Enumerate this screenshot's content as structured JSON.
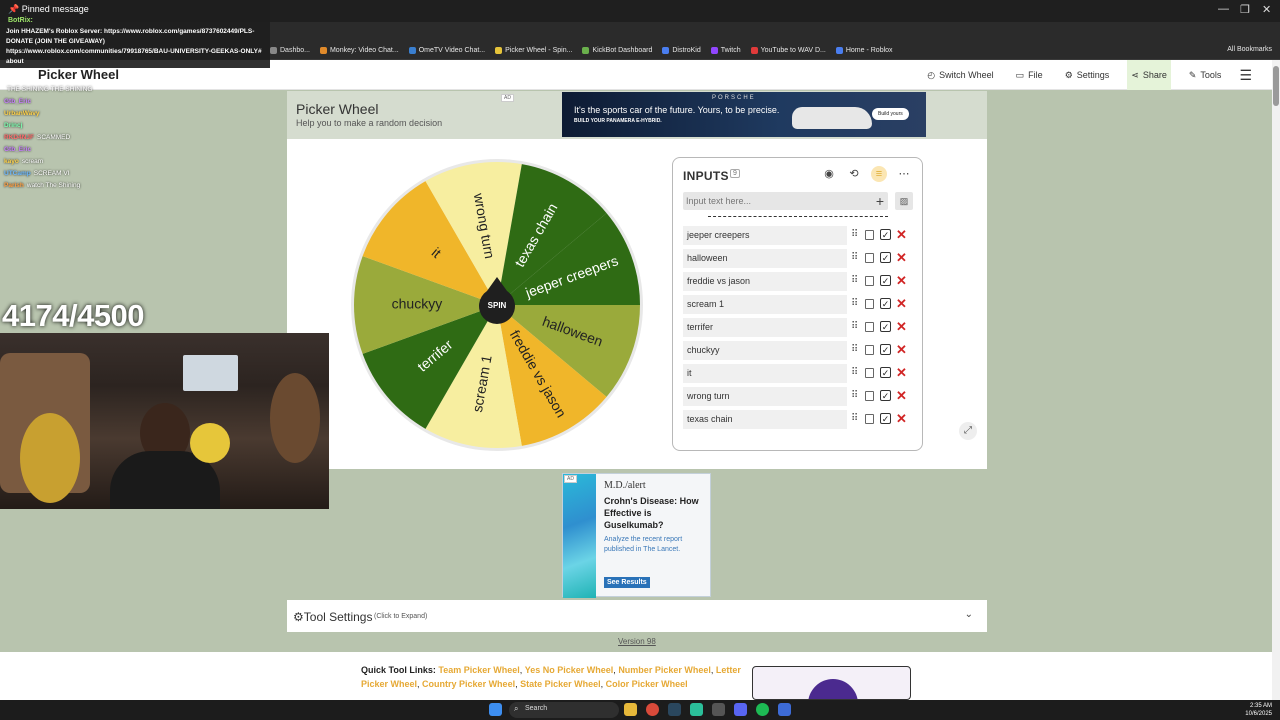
{
  "browser": {
    "bookmarks": [
      "Dashbo...",
      "Monkey: Video Chat...",
      "OmeTV Video Chat...",
      "Picker Wheel - Spin...",
      "KickBot Dashboard",
      "DistroKid",
      "Twitch",
      "YouTube to WAV D...",
      "Home - Roblox"
    ],
    "bookmark_colors": [
      "#888888",
      "#e08a2a",
      "#3a7fd0",
      "#e6c43a",
      "#6ab04c",
      "#4a7ef0",
      "#9146ff",
      "#e03a3a",
      "#4a7ef0"
    ],
    "all_bookmarks": "All Bookmarks"
  },
  "nav": {
    "brand": "Picker Wheel",
    "items": [
      {
        "label": "Switch Wheel",
        "icon": "history-icon"
      },
      {
        "label": "File",
        "icon": "file-icon"
      },
      {
        "label": "Settings",
        "icon": "gear-icon"
      },
      {
        "label": "Share",
        "icon": "share-icon"
      },
      {
        "label": "Tools",
        "icon": "tools-icon"
      }
    ]
  },
  "header": {
    "title": "Picker Wheel",
    "subtitle": "Help you to make a random decision",
    "ad_tag": "AD"
  },
  "ad_top": {
    "brand": "PORSCHE",
    "line1": "It's the sports car of the future. Yours, to be precise.",
    "line2": "BUILD YOUR PANAMERA E-HYBRID.",
    "button": "Build yours"
  },
  "wheel": {
    "spin_label": "SPIN",
    "segments": [
      {
        "label": "jeeper creepers",
        "color": "#2f6b14"
      },
      {
        "label": "halloween",
        "color": "#9aaa3b"
      },
      {
        "label": "freddie vs jason",
        "color": "#f0b62a"
      },
      {
        "label": "scream 1",
        "color": "#f7eea0"
      },
      {
        "label": "terrifer",
        "color": "#2f6b14"
      },
      {
        "label": "chuckyy",
        "color": "#9aaa3b"
      },
      {
        "label": "it",
        "color": "#f0b62a"
      },
      {
        "label": "wrong turn",
        "color": "#f7eea0"
      },
      {
        "label": "texas chain",
        "color": "#2f6b14"
      }
    ]
  },
  "inputs": {
    "title": "INPUTS",
    "count": "9",
    "placeholder": "Input text here...",
    "entries": [
      "jeeper creepers",
      "halloween",
      "freddie vs jason",
      "scream 1",
      "terrifer",
      "chuckyy",
      "it",
      "wrong turn",
      "texas chain"
    ]
  },
  "ad_mid": {
    "brand": "M.D./alert",
    "headline": "Crohn's Disease: How Effective is Guselkumab?",
    "body": "Analyze the recent report published in The Lancet.",
    "cta": "See Results"
  },
  "tool_settings": {
    "label": "Tool Settings",
    "hint": "(Click to Expand)"
  },
  "version": "Version 98",
  "quick_links": {
    "label": "Quick Tool Links:",
    "items": [
      "Team Picker Wheel",
      "Yes No Picker Wheel",
      "Number Picker Wheel",
      "Letter Picker Wheel",
      "Country Picker Wheel",
      "State Picker Wheel",
      "Color Picker Wheel"
    ]
  },
  "stream": {
    "pinned_title": "Pinned message",
    "pinned_author": "BotRix:",
    "pinned_message": "Join HHAZEM's Roblox Server: https://www.roblox.com/games/8737602449/PLS-DONATE (JOIN THE GIVEAWAY) https://www.roblox.com/communities/79918765/BAU-UNIVERSITY-GEEKAS-ONLY# about",
    "chat": [
      {
        "user": "",
        "text": "THE SHINING THE SHINING",
        "color": "#9ee66a"
      },
      {
        "user": "Gtb_Eric",
        "text": "",
        "color": "#c77dff"
      },
      {
        "user": "UrbanWavy",
        "text": "",
        "color": "#ffd24a"
      },
      {
        "user": "Drincj",
        "text": "",
        "color": "#7cffb0"
      },
      {
        "user": "RKD4NJF",
        "text": "SCAMMED",
        "color": "#ff6b6b"
      },
      {
        "user": "Gtb_Eric",
        "text": "",
        "color": "#c77dff"
      },
      {
        "user": "kayo",
        "text": "scream",
        "color": "#ffd24a"
      },
      {
        "user": "UTCamp",
        "text": "SCREAM VI",
        "color": "#6bb8ff"
      },
      {
        "user": "Parish",
        "text": "watch The Shining",
        "color": "#ff9f43"
      }
    ],
    "counter": "4174/4500"
  },
  "taskbar": {
    "search": "Search",
    "time": "2:35 AM",
    "date": "10/6/2025"
  }
}
